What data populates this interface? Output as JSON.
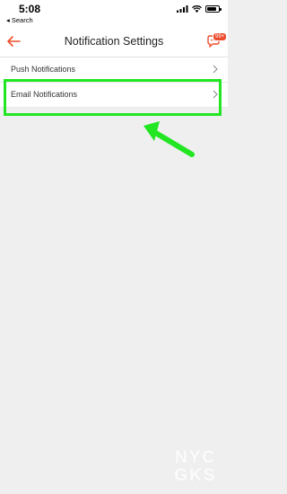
{
  "status_bar": {
    "time": "5:08",
    "back_app": "◂ Search",
    "icons": [
      "signal-icon",
      "wifi-icon",
      "battery-icon"
    ],
    "battery_level": 0.8
  },
  "header": {
    "title": "Notification Settings",
    "chat_badge": "99+",
    "accent_color": "#ee4d2d"
  },
  "settings": {
    "items": [
      {
        "label": "Push Notifications"
      },
      {
        "label": "Email Notifications"
      }
    ]
  },
  "annotation": {
    "color": "#22e622"
  },
  "watermark": {
    "line1": "NYC",
    "line2": "GKS"
  }
}
